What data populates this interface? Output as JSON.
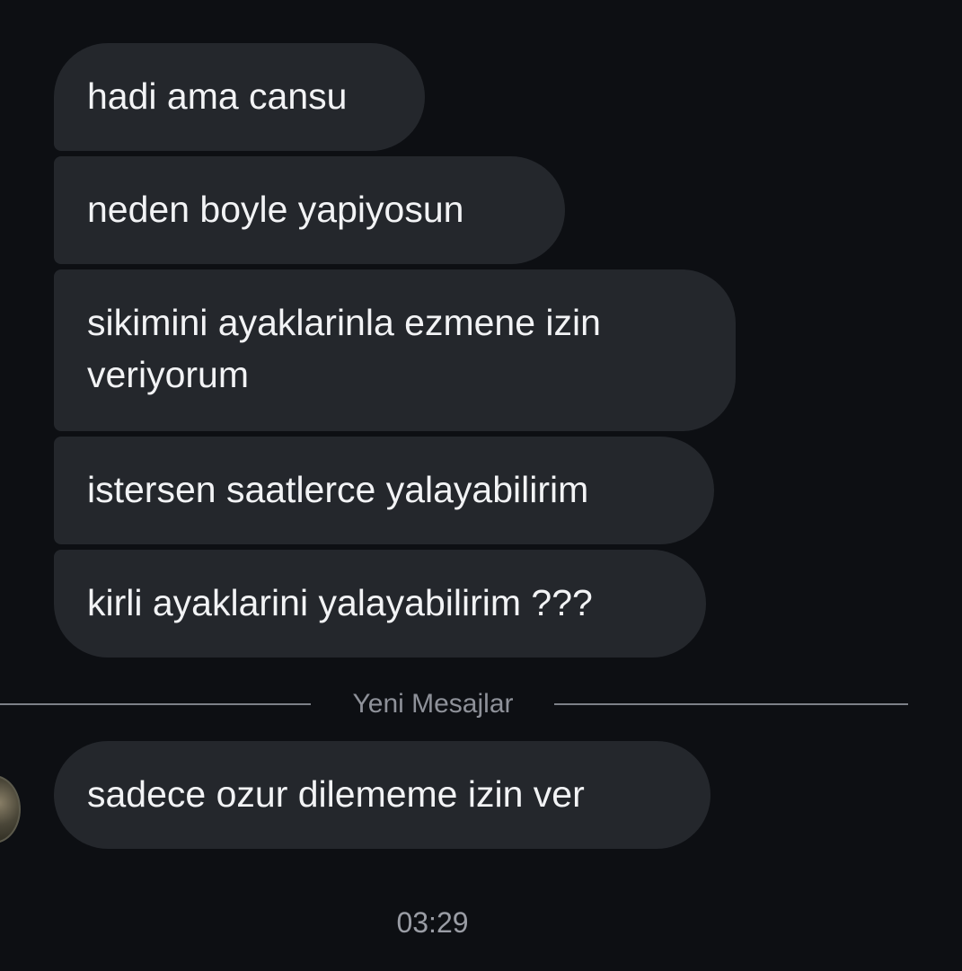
{
  "messages": [
    {
      "text": "hadi ama cansu"
    },
    {
      "text": "neden boyle yapiyosun"
    },
    {
      "text": "sikimini ayaklarinla ezmene izin veriyorum"
    },
    {
      "text": "istersen saatlerce yalayabilirim"
    },
    {
      "text": "kirli ayaklarini yalayabilirim ???"
    }
  ],
  "divider": {
    "label": "Yeni Mesajlar"
  },
  "new_messages": [
    {
      "text": "sadece ozur dilememe izin ver"
    }
  ],
  "timestamp": "03:29",
  "colors": {
    "background": "#0d0f13",
    "bubble": "#24272c",
    "text": "#f2f3f5",
    "muted": "#8e9199"
  }
}
